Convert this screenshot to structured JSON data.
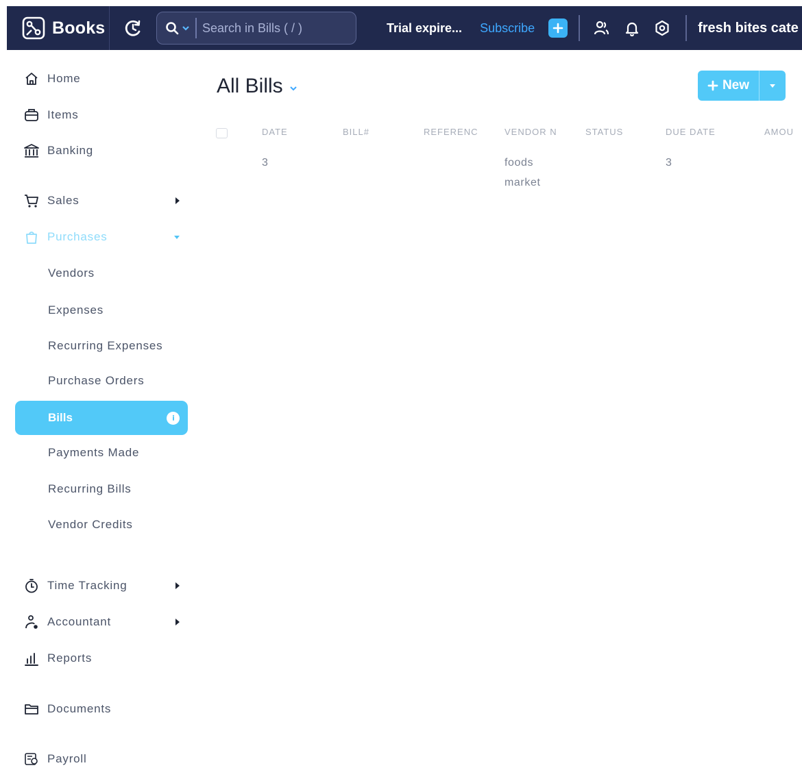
{
  "app": {
    "name": "Books"
  },
  "topbar": {
    "search_placeholder": "Search in Bills ( / )",
    "trial_text": "Trial expire...",
    "subscribe_label": "Subscribe",
    "org_name": "fresh bites cate"
  },
  "sidebar": {
    "home": "Home",
    "items": "Items",
    "banking": "Banking",
    "sales": "Sales",
    "purchases": "Purchases",
    "purchase_sub": [
      "Vendors",
      "Expenses",
      "Recurring Expenses",
      "Purchase Orders",
      "Bills",
      "Payments Made",
      "Recurring Bills",
      "Vendor Credits"
    ],
    "time_tracking": "Time Tracking",
    "accountant": "Accountant",
    "reports": "Reports",
    "documents": "Documents",
    "payroll": "Payroll"
  },
  "main": {
    "title": "All Bills",
    "new_label": "New",
    "columns": [
      "DATE",
      "BILL#",
      "REFERENC",
      "VENDOR N",
      "STATUS",
      "DUE DATE",
      "AMOU"
    ],
    "rows": [
      {
        "date": "3",
        "bill": "",
        "reference": "",
        "vendor_line1": "foods",
        "vendor_line2": "market",
        "status": "",
        "due_date": "3",
        "amount": ""
      }
    ]
  },
  "colors": {
    "topbar": "#20294d",
    "accent": "#52c9f8",
    "link": "#3ea8ff"
  }
}
